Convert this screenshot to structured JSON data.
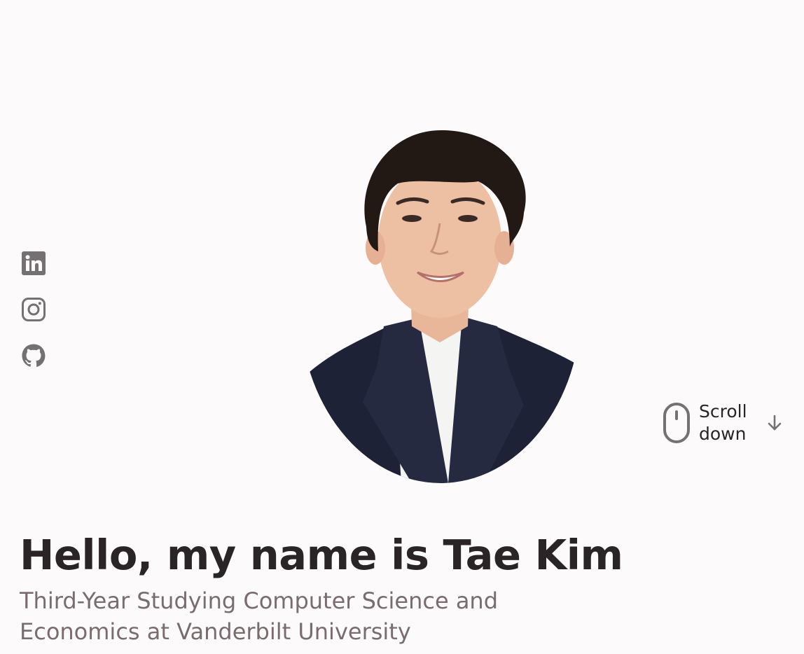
{
  "hero": {
    "title": "Hello, my name is Tae Kim",
    "subtitle": "Third-Year Studying Computer Science and Economics at Vanderbilt University"
  },
  "social": [
    {
      "icon": "linkedin-icon"
    },
    {
      "icon": "instagram-icon"
    },
    {
      "icon": "github-icon"
    }
  ],
  "scroll": {
    "label": "Scroll down",
    "icon": "mouse-icon",
    "arrow_icon": "arrow-down-icon"
  },
  "colors": {
    "background": "#fcfafb",
    "title": "#2a2426",
    "subtitle": "#7a6c6e",
    "icon": "#757072"
  }
}
